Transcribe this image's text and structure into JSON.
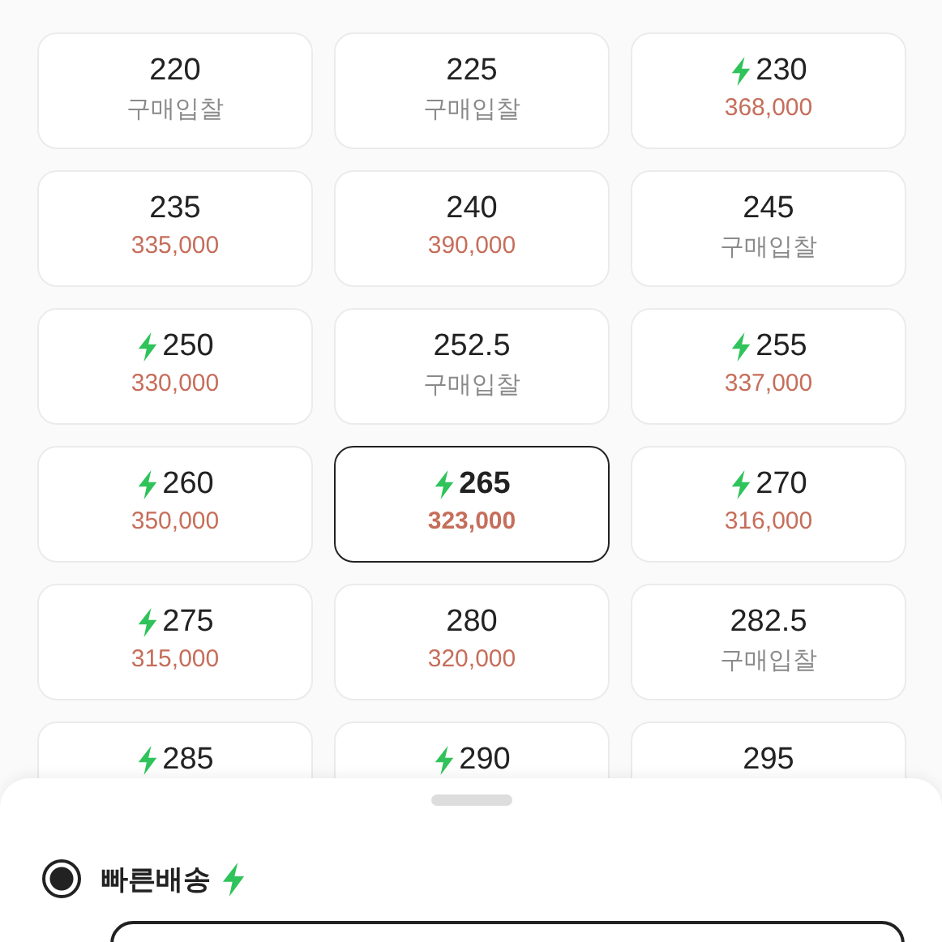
{
  "sizes": [
    {
      "size": "220",
      "fast": false,
      "selected": false,
      "price": {
        "kind": "bid",
        "text": "구매입찰"
      }
    },
    {
      "size": "225",
      "fast": false,
      "selected": false,
      "price": {
        "kind": "bid",
        "text": "구매입찰"
      }
    },
    {
      "size": "230",
      "fast": true,
      "selected": false,
      "price": {
        "kind": "price",
        "text": "368,000"
      }
    },
    {
      "size": "235",
      "fast": false,
      "selected": false,
      "price": {
        "kind": "price",
        "text": "335,000"
      }
    },
    {
      "size": "240",
      "fast": false,
      "selected": false,
      "price": {
        "kind": "price",
        "text": "390,000"
      }
    },
    {
      "size": "245",
      "fast": false,
      "selected": false,
      "price": {
        "kind": "bid",
        "text": "구매입찰"
      }
    },
    {
      "size": "250",
      "fast": true,
      "selected": false,
      "price": {
        "kind": "price",
        "text": "330,000"
      }
    },
    {
      "size": "252.5",
      "fast": false,
      "selected": false,
      "price": {
        "kind": "bid",
        "text": "구매입찰"
      }
    },
    {
      "size": "255",
      "fast": true,
      "selected": false,
      "price": {
        "kind": "price",
        "text": "337,000"
      }
    },
    {
      "size": "260",
      "fast": true,
      "selected": false,
      "price": {
        "kind": "price",
        "text": "350,000"
      }
    },
    {
      "size": "265",
      "fast": true,
      "selected": true,
      "price": {
        "kind": "price",
        "text": "323,000"
      }
    },
    {
      "size": "270",
      "fast": true,
      "selected": false,
      "price": {
        "kind": "price",
        "text": "316,000"
      }
    },
    {
      "size": "275",
      "fast": true,
      "selected": false,
      "price": {
        "kind": "price",
        "text": "315,000"
      }
    },
    {
      "size": "280",
      "fast": false,
      "selected": false,
      "price": {
        "kind": "price",
        "text": "320,000"
      }
    },
    {
      "size": "282.5",
      "fast": false,
      "selected": false,
      "price": {
        "kind": "bid",
        "text": "구매입찰"
      }
    },
    {
      "size": "285",
      "fast": true,
      "selected": false
    },
    {
      "size": "290",
      "fast": true,
      "selected": false
    },
    {
      "size": "295",
      "fast": false,
      "selected": false
    }
  ],
  "sheet": {
    "options": [
      {
        "label": "빠른배송",
        "fast": true,
        "selected": true
      }
    ]
  }
}
